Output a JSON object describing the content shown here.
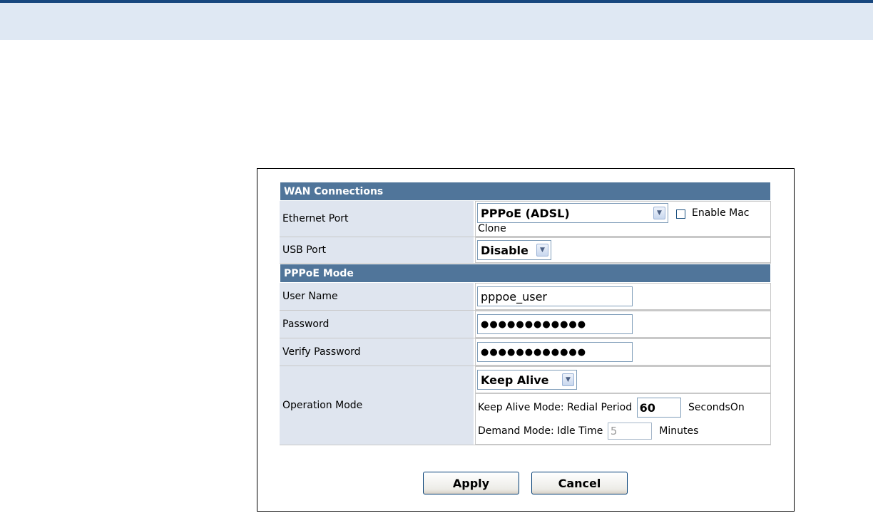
{
  "sections": {
    "wan_connections": "WAN Connections",
    "pppoe_mode": "PPPoE Mode"
  },
  "ethernet_port": {
    "label": "Ethernet Port",
    "selected": "PPPoE (ADSL)",
    "mac_clone_label_1": "Enable Mac",
    "mac_clone_label_2": "Clone"
  },
  "usb_port": {
    "label": "USB Port",
    "selected": "Disable"
  },
  "user_name": {
    "label": "User Name",
    "value": "pppoe_user"
  },
  "password": {
    "label": "Password",
    "masked": "●●●●●●●●●●●●"
  },
  "verify_password": {
    "label": "Verify Password",
    "masked": "●●●●●●●●●●●●"
  },
  "operation_mode": {
    "label": "Operation Mode",
    "selected": "Keep Alive",
    "keep_alive_label": "Keep Alive Mode: Redial Period",
    "redial_period": "60",
    "seconds_label": "SecondsOn",
    "demand_label": "Demand Mode: Idle Time",
    "idle_time": "5",
    "minutes_label": "Minutes"
  },
  "buttons": {
    "apply": "Apply",
    "cancel": "Cancel"
  },
  "colors": {
    "section_header": "#50759a",
    "label_bg": "#dfe5ef",
    "top_bar": "#dfe8f3",
    "top_border": "#17477e"
  }
}
